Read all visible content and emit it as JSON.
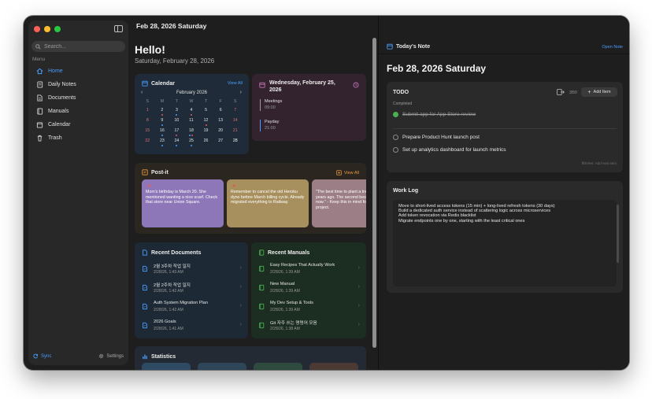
{
  "window": {
    "traffic_colors": [
      "#ff5f57",
      "#febc2e",
      "#28c840"
    ]
  },
  "sidebar": {
    "search_placeholder": "Search...",
    "menu_label": "Menu",
    "items": [
      {
        "label": "Home",
        "icon": "home-icon",
        "active": true
      },
      {
        "label": "Daily Notes",
        "icon": "notebook-icon"
      },
      {
        "label": "Documents",
        "icon": "document-icon"
      },
      {
        "label": "Manuals",
        "icon": "book-icon"
      },
      {
        "label": "Calendar",
        "icon": "calendar-icon"
      },
      {
        "label": "Trash",
        "icon": "trash-icon"
      }
    ],
    "sync_label": "Sync",
    "settings_label": "Settings"
  },
  "header": {
    "date": "Feb 28, 2026 Saturday"
  },
  "home": {
    "greeting": "Hello!",
    "subtitle": "Saturday, February 28, 2026"
  },
  "calendar": {
    "title": "Calendar",
    "view_all": "View All",
    "month": "February 2026",
    "weekdays": [
      "S",
      "M",
      "T",
      "W",
      "T",
      "F",
      "S"
    ],
    "weeks": [
      [
        "1",
        "2",
        "3",
        "4",
        "5",
        "6",
        "7"
      ],
      [
        "8",
        "9",
        "10",
        "11",
        "12",
        "13",
        "14"
      ],
      [
        "15",
        "16",
        "17",
        "18",
        "19",
        "20",
        "21"
      ],
      [
        "22",
        "23",
        "24",
        "25",
        "26",
        "27",
        "28"
      ]
    ],
    "today": "28",
    "accent": "#3b8eea"
  },
  "agenda": {
    "heading": "Wednesday, February 25, 2026",
    "events": [
      {
        "title": "Meetings",
        "time": "09:00",
        "color": "#9a9a9a"
      },
      {
        "title": "Payday",
        "time": "21:00",
        "color": "#4a9eff"
      }
    ]
  },
  "postit": {
    "title": "Post-it",
    "view_all": "View All",
    "notes": [
      {
        "text": "Mom's birthday is March 20. She mentioned wanting a nice scarf. Check that store near Union Square.",
        "color": "#8e77b8"
      },
      {
        "text": "Remember to cancel the old Heroku dyno before March billing cycle. Already migrated everything to Railway.",
        "color": "#a8905e"
      },
      {
        "text": "\"The best time to plant a tree was 20 years ago. The second best time is now.\" - Keep this in mind for the side project.",
        "color": "#9c7e86"
      }
    ]
  },
  "recent_documents": {
    "title": "Recent Documents",
    "items": [
      {
        "title": "2월 3주차 작업 일지",
        "date": "2/28/26, 1:43 AM"
      },
      {
        "title": "2월 2주차 작업 일지",
        "date": "2/28/26, 1:42 AM"
      },
      {
        "title": "Auth System Migration Plan",
        "date": "2/28/26, 1:42 AM"
      },
      {
        "title": "2026 Goals",
        "date": "2/28/26, 1:41 AM"
      }
    ]
  },
  "recent_manuals": {
    "title": "Recent Manuals",
    "items": [
      {
        "title": "Easy Recipes That Actually Work",
        "date": "2/28/26, 1:39 AM"
      },
      {
        "title": "New Manual",
        "date": "2/28/26, 1:39 AM"
      },
      {
        "title": "My Dev Setup & Tools",
        "date": "2/28/26, 1:39 AM"
      },
      {
        "title": "Git 자주 쓰는 명령어 모음",
        "date": "2/28/26, 1:38 AM"
      }
    ]
  },
  "statistics": {
    "title": "Statistics",
    "pill_colors": [
      "#2f4a63",
      "#2e4658",
      "#2f4a3f",
      "#4a3a33"
    ]
  },
  "today_note": {
    "title": "Today's Note",
    "open_note": "Open Note",
    "date": "Feb 28, 2026 Saturday",
    "todo": {
      "title": "TODO",
      "count": "3/50",
      "add_label": "Add Item",
      "completed_label": "Completed",
      "completed": [
        "Submit app for App Store review"
      ],
      "open": [
        "Prepare Product Hunt launch post",
        "Set up analytics dashboard for launch metrics"
      ],
      "hint": "⌘Enter: Add new item"
    },
    "worklog": {
      "title": "Work Log",
      "lines": [
        "Move to short-lived access tokens (15 min) + long-lived refresh tokens (30 days)",
        "Build a dedicated auth service instead of scattering logic across microservices",
        "Add token revocation via Redis blacklist",
        "Migrate endpoints one by one, starting with the least critical ones"
      ]
    }
  }
}
